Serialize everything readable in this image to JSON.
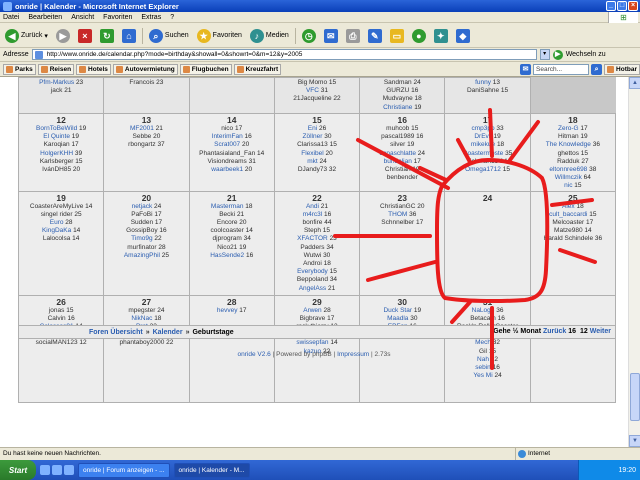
{
  "window": {
    "title": "onride | Kalender - Microsoft Internet Explorer"
  },
  "menu": [
    "Datei",
    "Bearbeiten",
    "Ansicht",
    "Favoriten",
    "Extras",
    "?"
  ],
  "toolbar": {
    "back": "Zurück",
    "search": "Suchen",
    "favorites": "Favoriten",
    "media": "Medien"
  },
  "address": {
    "label": "Adresse",
    "url": "http://www.onride.de/calendar.php?mode=birthday&showall=0&showrt=0&m=12&y=2005",
    "go": "Wechseln zu"
  },
  "links": [
    "Parks",
    "Reisen",
    "Hotels",
    "Autovermietung",
    "Flugbuchen",
    "Kreuzfahrt"
  ],
  "links_search": "Search...",
  "links_hotbar": "Hotbar",
  "calendar": {
    "rows": [
      [
        {
          "day": "",
          "entries": [
            [
              "Pfm-Markus",
              "23",
              "link"
            ],
            [
              "jack",
              "21",
              "plain"
            ]
          ]
        },
        {
          "day": "",
          "entries": [
            [
              "Francois",
              "23",
              "plain"
            ]
          ]
        },
        {
          "day": "",
          "entries": []
        },
        {
          "day": "",
          "entries": [
            [
              "Big Momo",
              "15",
              "plain"
            ],
            [
              "VFC",
              "31",
              "link"
            ],
            [
              "21Jacqueline",
              "22",
              "plain"
            ]
          ]
        },
        {
          "day": "",
          "entries": [
            [
              "Sandman",
              "24",
              "plain"
            ],
            [
              "GURZU",
              "16",
              "plain"
            ],
            [
              "Mudvayne",
              "18",
              "plain"
            ],
            [
              "Christiane",
              "19",
              "link"
            ]
          ]
        },
        {
          "day": "",
          "entries": [
            [
              "funny",
              "13",
              "link"
            ],
            [
              "DaniSahne",
              "15",
              "plain"
            ]
          ]
        }
      ],
      [
        {
          "day": "12",
          "entries": [
            [
              "BornToBeWild",
              "19",
              "link"
            ],
            [
              "El Quinte",
              "19",
              "link"
            ],
            [
              "Karoqian",
              "17",
              "plain"
            ],
            [
              "HolgerKHH",
              "39",
              "link"
            ],
            [
              "Karlsberger",
              "15",
              "plain"
            ],
            [
              "IvánDH85",
              "20",
              "plain"
            ]
          ]
        },
        {
          "day": "13",
          "entries": [
            [
              "MF2001",
              "21",
              "link"
            ],
            [
              "Sebbe",
              "20",
              "plain"
            ],
            [
              "rbongartz",
              "37",
              "plain"
            ]
          ]
        },
        {
          "day": "14",
          "entries": [
            [
              "nico",
              "17",
              "plain"
            ],
            [
              "InterimFan",
              "16",
              "link"
            ],
            [
              "Scrat007",
              "20",
              "link"
            ],
            [
              "Phantasialand_Fan",
              "14",
              "plain"
            ],
            [
              "Visiondreams",
              "31",
              "plain"
            ],
            [
              "waarbeek1",
              "20",
              "link"
            ]
          ]
        },
        {
          "day": "15",
          "entries": [
            [
              "Eni",
              "26",
              "link"
            ],
            [
              "Zöllner",
              "30",
              "link"
            ],
            [
              "Clarissa13",
              "15",
              "plain"
            ],
            [
              "Flexibel",
              "20",
              "link"
            ],
            [
              "mkt",
              "24",
              "link"
            ],
            [
              "DJandy73",
              "32",
              "plain"
            ]
          ]
        },
        {
          "day": "16",
          "entries": [
            [
              "muhcob",
              "15",
              "plain"
            ],
            [
              "pascal1989",
              "16",
              "plain"
            ],
            [
              "silver",
              "19",
              "plain"
            ],
            [
              "Jonaschlatte",
              "24",
              "link"
            ],
            [
              "bundalian",
              "17",
              "link"
            ],
            [
              "Christian",
              "19",
              "plain"
            ],
            [
              "benbender",
              "",
              "plain"
            ]
          ]
        },
        {
          "day": "17",
          "entries": [
            [
              "cmp3po",
              "33",
              "link"
            ],
            [
              "DrEvil",
              "19",
              "link"
            ],
            [
              "mikekue",
              "18",
              "link"
            ],
            [
              "Coastermoste",
              "35",
              "link"
            ],
            [
              "richman13",
              "14",
              "plain"
            ],
            [
              "Omega1712",
              "15",
              "link"
            ]
          ]
        },
        {
          "day": "18",
          "entries": [
            [
              "Zero-G",
              "17",
              "link"
            ],
            [
              "Hitman",
              "19",
              "plain"
            ],
            [
              "The Knowledge",
              "36",
              "link"
            ],
            [
              "ghettos",
              "15",
              "plain"
            ],
            [
              "Radduk",
              "27",
              "plain"
            ],
            [
              "eltonnree698",
              "38",
              "link"
            ],
            [
              "Willmczik",
              "64",
              "link"
            ],
            [
              "nic",
              "15",
              "link"
            ]
          ]
        }
      ],
      [
        {
          "day": "19",
          "entries": [
            [
              "CoasterAreMyLive",
              "14",
              "plain"
            ],
            [
              "singel rider",
              "25",
              "plain"
            ],
            [
              "Euro",
              "28",
              "link"
            ],
            [
              "KingDaKa",
              "14",
              "link"
            ],
            [
              "Lalocolsa",
              "14",
              "plain"
            ]
          ]
        },
        {
          "day": "20",
          "entries": [
            [
              "netjack",
              "24",
              "link"
            ],
            [
              "PaFoBi",
              "17",
              "plain"
            ],
            [
              "Sudden",
              "17",
              "plain"
            ],
            [
              "GossipBoy",
              "16",
              "plain"
            ],
            [
              "Timo9g",
              "22",
              "link"
            ],
            [
              "murfinator",
              "28",
              "plain"
            ],
            [
              "AmazingPhil",
              "25",
              "link"
            ]
          ]
        },
        {
          "day": "21",
          "entries": [
            [
              "Masterman",
              "18",
              "link"
            ],
            [
              "Becki",
              "21",
              "plain"
            ],
            [
              "Encore",
              "20",
              "plain"
            ],
            [
              "coolcoaster",
              "14",
              "plain"
            ],
            [
              "djprogram",
              "34",
              "plain"
            ],
            [
              "Nico21",
              "19",
              "plain"
            ],
            [
              "HasSende2",
              "16",
              "link"
            ]
          ]
        },
        {
          "day": "22",
          "entries": [
            [
              "Andi",
              "21",
              "link"
            ],
            [
              "m4rc3l",
              "16",
              "link"
            ],
            [
              "bonfire",
              "44",
              "plain"
            ],
            [
              "Steph",
              "15",
              "plain"
            ],
            [
              "XFACTOR",
              "23",
              "link"
            ],
            [
              "Padders",
              "34",
              "plain"
            ],
            [
              "Wutwi",
              "30",
              "plain"
            ],
            [
              "Androi",
              "18",
              "plain"
            ],
            [
              "Everybody",
              "15",
              "link"
            ],
            [
              "Beppoland",
              "34",
              "plain"
            ],
            [
              "AngelAss",
              "21",
              "link"
            ]
          ]
        },
        {
          "day": "23",
          "entries": [
            [
              "ChristianGC",
              "20",
              "plain"
            ],
            [
              "THOM",
              "36",
              "link"
            ],
            [
              "Schnnelber",
              "17",
              "plain"
            ]
          ]
        },
        {
          "day": "24",
          "entries": []
        },
        {
          "day": "25",
          "entries": [
            [
              "Alex",
              "18",
              "link"
            ],
            [
              "cult_baccardi",
              "15",
              "link"
            ],
            [
              "Melcoaster",
              "17",
              "plain"
            ],
            [
              "Matze980",
              "14",
              "plain"
            ],
            [
              "Harald Schindele",
              "36",
              "plain"
            ]
          ]
        }
      ],
      [
        {
          "day": "26",
          "entries": [
            [
              "jonas",
              "15",
              "plain"
            ],
            [
              "Calvin",
              "16",
              "plain"
            ],
            [
              "Colossos91",
              "14",
              "link"
            ],
            [
              "Jill",
              "20",
              "plain"
            ],
            [
              "socialMAN123",
              "12",
              "plain"
            ]
          ]
        },
        {
          "day": "27",
          "entries": [
            [
              "mpegster",
              "24",
              "plain"
            ],
            [
              "NikNac",
              "18",
              "link"
            ],
            [
              "Brot",
              "22",
              "link"
            ],
            [
              "daulfes",
              "43",
              "link"
            ],
            [
              "phantaboy2000",
              "22",
              "plain"
            ]
          ]
        },
        {
          "day": "28",
          "entries": [
            [
              "hevvey",
              "17",
              "link"
            ]
          ]
        },
        {
          "day": "29",
          "entries": [
            [
              "Arwen",
              "28",
              "link"
            ],
            [
              "Bigbrave",
              "17",
              "plain"
            ],
            [
              "rock thierry",
              "13",
              "plain"
            ],
            [
              "Morgrav",
              "19",
              "link"
            ],
            [
              "swissepfan",
              "14",
              "link"
            ],
            [
              "kazuo",
              "22",
              "link"
            ]
          ]
        },
        {
          "day": "30",
          "entries": [
            [
              "Duck Star",
              "19",
              "link"
            ],
            [
              "Maadla",
              "30",
              "link"
            ],
            [
              "EPFan",
              "16",
              "link"
            ],
            [
              "EffeJelle",
              "17",
              "plain"
            ]
          ]
        },
        {
          "day": "31",
          "entries": [
            [
              "NaLogo",
              "36",
              "link"
            ],
            [
              "Betacam",
              "16",
              "plain"
            ],
            [
              "Rock'n RollerCoaster",
              "",
              "plain"
            ],
            [
              "",
              "30",
              "plain"
            ],
            [
              "Mech",
              "32",
              "link"
            ],
            [
              "Gil",
              "15",
              "plain"
            ],
            [
              "Nah",
              "22",
              "link"
            ],
            [
              "sebin",
              "16",
              "link"
            ],
            [
              "Yes Mi",
              "24",
              "link"
            ]
          ]
        },
        {
          "day": "",
          "entries": []
        }
      ]
    ]
  },
  "nav": {
    "forum": "Foren Übersicht",
    "calendar": "Kalender",
    "birthdays": "Geburtstage",
    "goto": "Gehe ½ Monat",
    "back": "Zurück",
    "back_num": "16",
    "num": "12",
    "forward": "Weiter"
  },
  "footer": {
    "version": "onride V2.6",
    "powered": "Powered by phpBB",
    "impressum": "Impressum",
    "time": "2.73s"
  },
  "status": {
    "message": "Du hast keine neuen Nachrichten.",
    "zone": "Internet"
  },
  "taskbar": {
    "start": "Start",
    "tasks": [
      "onride | Forum anzeigen - ...",
      "onride | Kalender - M..."
    ],
    "clock": "19:20"
  },
  "annotation_color": "#e81c1c"
}
